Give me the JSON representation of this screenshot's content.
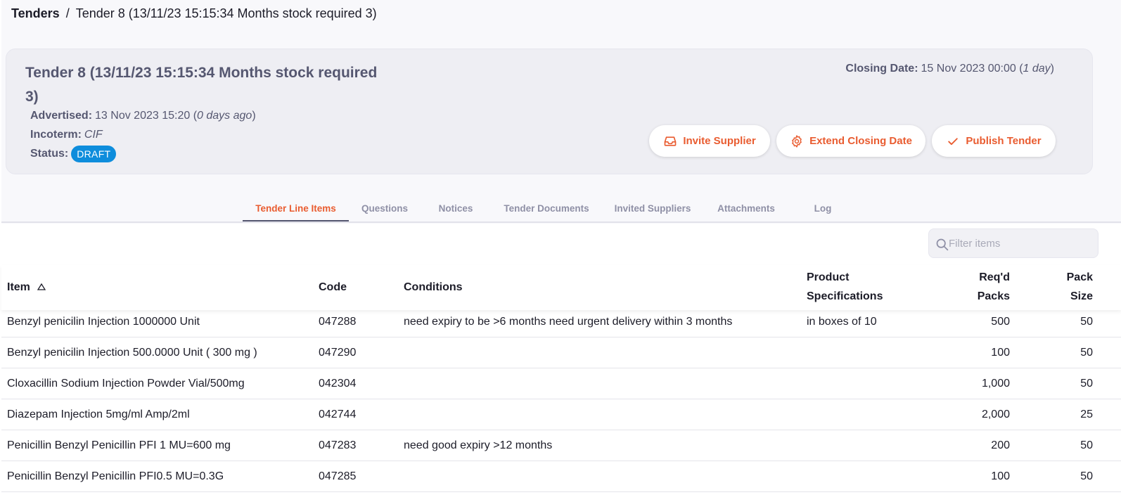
{
  "breadcrumb": {
    "root": "Tenders",
    "separator": "/",
    "current": "Tender 8 (13/11/23 15:15:34 Months stock required 3)"
  },
  "summary": {
    "title": "Tender 8 (13/11/23 15:15:34 Months stock required 3)",
    "advertised_label": "Advertised:",
    "advertised_value": "13 Nov 2023 15:20",
    "advertised_relative": "0 days ago",
    "incoterm_label": "Incoterm:",
    "incoterm_value": "CIF",
    "status_label": "Status:",
    "status_value": "DRAFT",
    "closing_label": "Closing Date:",
    "closing_value": "15 Nov 2023 00:00",
    "closing_relative": "1 day"
  },
  "actions": {
    "invite_supplier": "Invite Supplier",
    "extend_closing_date": "Extend Closing Date",
    "publish_tender": "Publish Tender"
  },
  "tabs": [
    {
      "label": "Tender Line Items",
      "active": true
    },
    {
      "label": "Questions",
      "active": false
    },
    {
      "label": "Notices",
      "active": false
    },
    {
      "label": "Tender Documents",
      "active": false
    },
    {
      "label": "Invited Suppliers",
      "active": false
    },
    {
      "label": "Attachments",
      "active": false
    },
    {
      "label": "Log",
      "active": false
    }
  ],
  "filter": {
    "placeholder": "Filter items",
    "value": ""
  },
  "table": {
    "headers": {
      "item": "Item",
      "code": "Code",
      "conditions": "Conditions",
      "spec_line1": "Product",
      "spec_line2": "Specifications",
      "req_line1": "Req'd",
      "req_line2": "Packs",
      "pack_line1": "Pack",
      "pack_line2": "Size"
    },
    "sort_column": "item",
    "rows": [
      {
        "item": "Benzyl penicilin Injection 1000000 Unit",
        "code": "047288",
        "conditions": "need expiry to be >6 months need urgent delivery within 3 months",
        "spec": "in boxes of 10",
        "req_packs": "500",
        "pack_size": "50"
      },
      {
        "item": "Benzyl penicilin Injection 500.0000 Unit ( 300 mg )",
        "code": "047290",
        "conditions": "",
        "spec": "",
        "req_packs": "100",
        "pack_size": "50"
      },
      {
        "item": "Cloxacillin Sodium Injection Powder Vial/500mg",
        "code": "042304",
        "conditions": "",
        "spec": "",
        "req_packs": "1,000",
        "pack_size": "50"
      },
      {
        "item": "Diazepam Injection 5mg/ml Amp/2ml",
        "code": "042744",
        "conditions": "",
        "spec": "",
        "req_packs": "2,000",
        "pack_size": "25"
      },
      {
        "item": "Penicillin Benzyl Penicillin PFI 1 MU=600 mg",
        "code": "047283",
        "conditions": "need good expiry >12 months",
        "spec": "",
        "req_packs": "200",
        "pack_size": "50"
      },
      {
        "item": "Penicillin Benzyl Penicillin PFI0.5 MU=0.3G",
        "code": "047285",
        "conditions": "",
        "spec": "",
        "req_packs": "100",
        "pack_size": "50"
      }
    ]
  },
  "colors": {
    "accent": "#e95c30",
    "status_badge": "#0e8ddc",
    "muted_text": "#555770"
  },
  "icons": {
    "invite": "inbox-icon",
    "extend": "gear-icon",
    "publish": "check-icon",
    "filter": "search-icon",
    "sort": "sort-ascending-icon"
  }
}
